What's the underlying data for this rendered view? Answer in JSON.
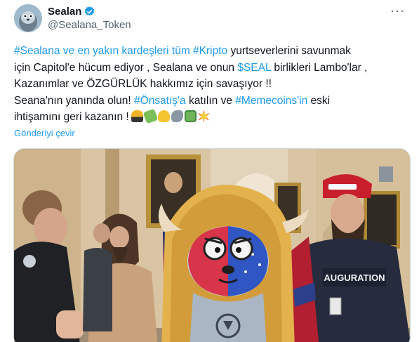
{
  "author": {
    "display_name": "Sealan",
    "handle": "@Sealana_Token",
    "avatar": "seal-avatar-icon",
    "verified": "verified-badge-icon"
  },
  "more_menu": "more-icon",
  "tweet_text": {
    "line1_parts": [
      "#Sealana ve en yakın kardeşleri tüm #Kripto",
      " yurtseverlerini savunmak"
    ],
    "line2_parts": [
      "için Capitol'e hücum ediyor , Sealana ve onun ",
      "$SEAL",
      " birlikleri Lambo'lar ,"
    ],
    "line3": "Kazanımlar ve ÖZGÜRLÜK hakkımız için savaşıyor !!",
    "line4_parts": [
      "Seana'nın yanında olun! ",
      "#Önsatış'a",
      " katılın ve ",
      "#Memecoins'in",
      " eski"
    ],
    "line5": "ihtişamını geri kazanın !",
    "emojis": [
      "car-emoji",
      "money-wings-emoji",
      "flexed-biceps-emoji",
      "seal-emoji",
      "dollar-bill-emoji",
      "collision-emoji"
    ]
  },
  "translate_label": "Gönderiyi çevir",
  "media": {
    "description_icon": "capitol-meme-image",
    "hat_text": "",
    "shirt_text": "AUGURATION"
  },
  "colors": {
    "link": "#1d9bf0",
    "text": "#0f1419",
    "secondary": "#536471",
    "border": "#cfd9de"
  }
}
